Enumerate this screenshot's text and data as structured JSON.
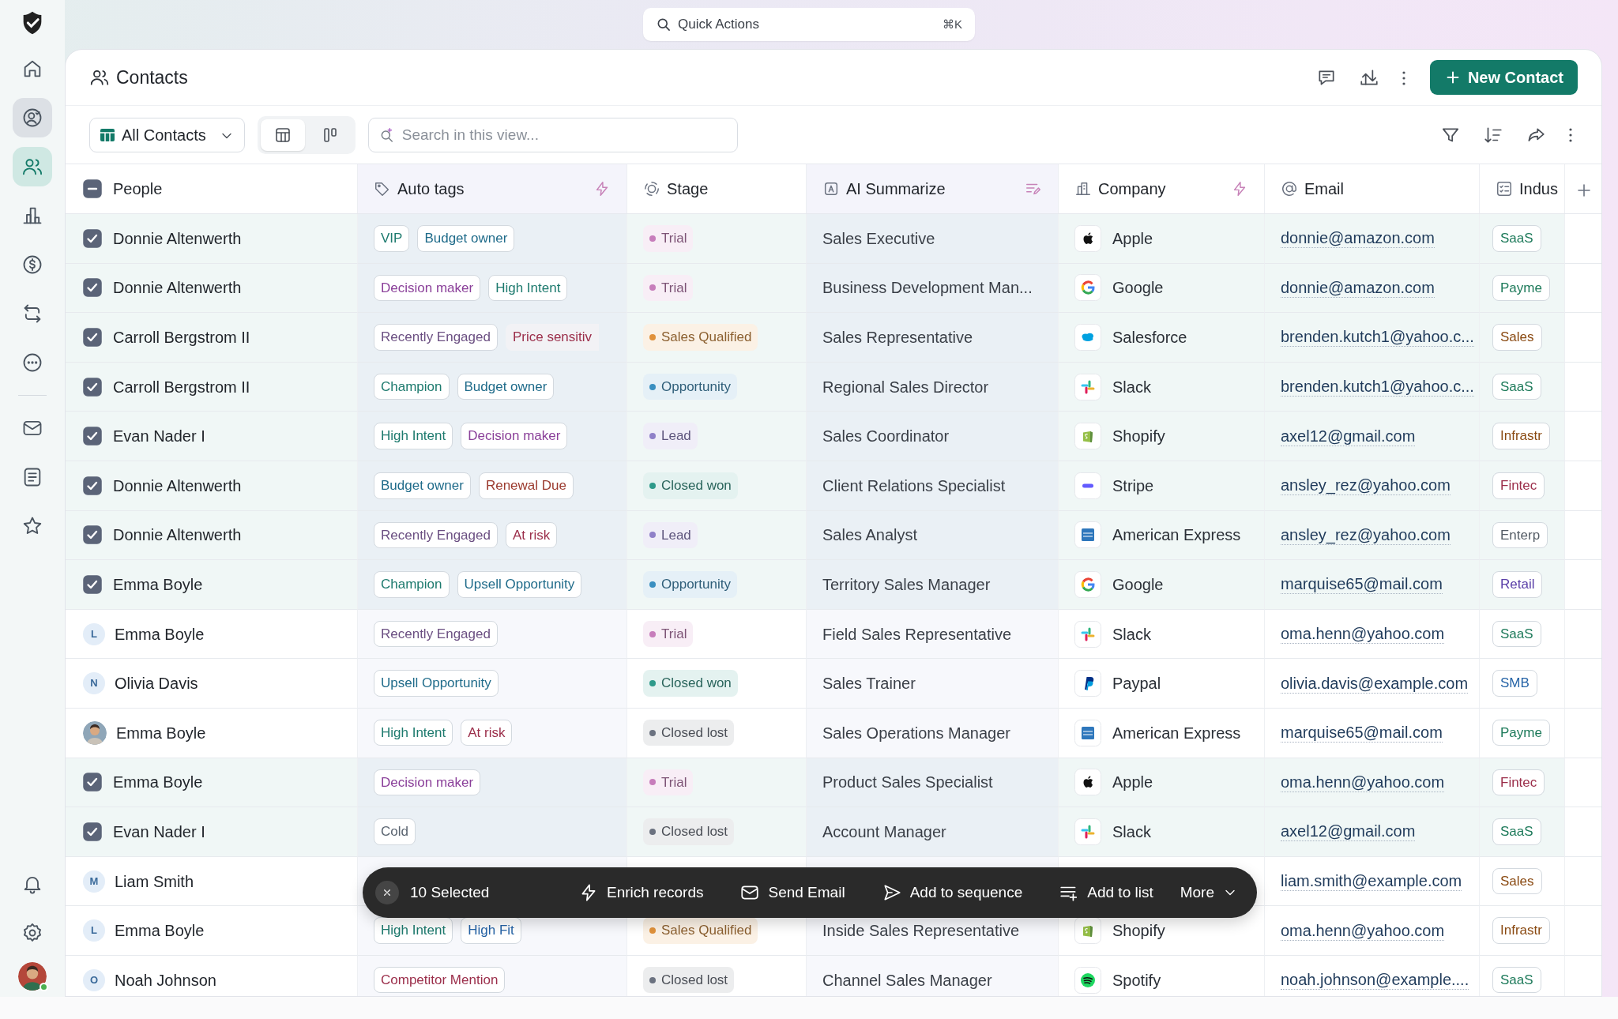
{
  "quick_actions": {
    "label": "Quick Actions",
    "shortcut": "⌘K"
  },
  "sidebar": {
    "items": [
      {
        "selected": false,
        "hovered": false
      },
      {
        "selected": false,
        "hovered": true
      },
      {
        "selected": true,
        "hovered": false
      },
      {
        "selected": false,
        "hovered": false
      },
      {
        "selected": false,
        "hovered": false
      },
      {
        "selected": false,
        "hovered": false
      },
      {
        "selected": false,
        "hovered": false
      },
      {
        "selected": false,
        "hovered": false
      },
      {
        "selected": false,
        "hovered": false
      },
      {
        "selected": false,
        "hovered": false
      }
    ],
    "bottom_items": [
      {
        "selected": false
      },
      {
        "selected": false
      }
    ],
    "user": {
      "online": true
    }
  },
  "header": {
    "title": "Contacts",
    "new_button": "New Contact"
  },
  "toolbar": {
    "view": "All Contacts",
    "view_modes": [
      {
        "selected": true
      },
      {
        "selected": false
      }
    ],
    "search": {
      "placeholder": "Search in this view..."
    }
  },
  "table": {
    "select_all": {
      "indeterminate": true
    },
    "columns": [
      {
        "label": "People"
      },
      {
        "label": "Auto tags"
      },
      {
        "label": "Stage"
      },
      {
        "label": "AI Summarize"
      },
      {
        "label": "Company"
      },
      {
        "label": "Email"
      },
      {
        "label": "Indus"
      }
    ],
    "rows": [
      {
        "checked": true,
        "name": "Donnie Altenwerth",
        "tags": [
          {
            "label": "VIP",
            "color": "#1d7a6e"
          },
          {
            "label": "Budget owner",
            "color": "#1f6b8a"
          }
        ],
        "stage": {
          "label": "Trial",
          "color": "#c77dbb"
        },
        "summary": "Sales Executive",
        "company": {
          "name": "Apple",
          "kind": "apple"
        },
        "email": "donnie@amazon.com",
        "industry": {
          "label": "SaaS",
          "color": "#1d7a5a"
        }
      },
      {
        "checked": true,
        "name": "Donnie Altenwerth",
        "tags": [
          {
            "label": "Decision maker",
            "color": "#8a3f99"
          },
          {
            "label": "High Intent",
            "color": "#1d7a6e"
          }
        ],
        "stage": {
          "label": "Trial",
          "color": "#c77dbb"
        },
        "summary": "Business Development Man...",
        "company": {
          "name": "Google",
          "kind": "google"
        },
        "email": "donnie@amazon.com",
        "industry": {
          "label": "Payme",
          "color": "#1d7a5a"
        }
      },
      {
        "checked": true,
        "name": "Carroll Bergstrom II",
        "tags": [
          {
            "label": "Recently Engaged",
            "color": "#6b4f82"
          },
          {
            "label": "Price sensitiv",
            "color": "#9b2e4a"
          }
        ],
        "stage": {
          "label": "Sales Qualified",
          "color": "#e0913a"
        },
        "summary": "Sales Representative",
        "company": {
          "name": "Salesforce",
          "kind": "salesforce"
        },
        "email": "brenden.kutch1@yahoo.c...",
        "industry": {
          "label": "Sales",
          "color": "#8a4a12"
        }
      },
      {
        "checked": true,
        "name": "Carroll Bergstrom II",
        "tags": [
          {
            "label": "Champion",
            "color": "#1d7a6e"
          },
          {
            "label": "Budget owner",
            "color": "#1f6b8a"
          }
        ],
        "stage": {
          "label": "Opportunity",
          "color": "#3a8fc0"
        },
        "summary": "Regional Sales Director",
        "company": {
          "name": "Slack",
          "kind": "slack"
        },
        "email": "brenden.kutch1@yahoo.c...",
        "industry": {
          "label": "SaaS",
          "color": "#1d7a5a"
        }
      },
      {
        "checked": true,
        "name": "Evan Nader I",
        "tags": [
          {
            "label": "High Intent",
            "color": "#1d7a6e"
          },
          {
            "label": "Decision maker",
            "color": "#8a3f99"
          }
        ],
        "stage": {
          "label": "Lead",
          "color": "#8f80c8"
        },
        "summary": "Sales Coordinator",
        "company": {
          "name": "Shopify",
          "kind": "shopify"
        },
        "email": "axel12@gmail.com",
        "industry": {
          "label": "Infrastr",
          "color": "#8a4a12"
        }
      },
      {
        "checked": true,
        "name": "Donnie Altenwerth",
        "tags": [
          {
            "label": "Budget owner",
            "color": "#1f6b8a"
          },
          {
            "label": "Renewal Due",
            "color": "#9b3a2e"
          }
        ],
        "stage": {
          "label": "Closed won",
          "color": "#2e9a8a"
        },
        "summary": "Client Relations Specialist",
        "company": {
          "name": "Stripe",
          "kind": "stripe"
        },
        "email": "ansley_rez@yahoo.com",
        "industry": {
          "label": "Fintec",
          "color": "#9b2e4a"
        }
      },
      {
        "checked": true,
        "name": "Donnie Altenwerth",
        "tags": [
          {
            "label": "Recently Engaged",
            "color": "#6b4f82"
          },
          {
            "label": "At risk",
            "color": "#9b2e4a"
          }
        ],
        "stage": {
          "label": "Lead",
          "color": "#8f80c8"
        },
        "summary": "Sales Analyst",
        "company": {
          "name": "American Express",
          "kind": "amex"
        },
        "email": "ansley_rez@yahoo.com",
        "industry": {
          "label": "Enterp",
          "color": "#555d66"
        }
      },
      {
        "checked": true,
        "name": "Emma Boyle",
        "tags": [
          {
            "label": "Champion",
            "color": "#1d7a6e"
          },
          {
            "label": "Upsell Opportunity",
            "color": "#1f6b8a"
          }
        ],
        "stage": {
          "label": "Opportunity",
          "color": "#3a8fc0"
        },
        "summary": "Territory Sales Manager",
        "company": {
          "name": "Google",
          "kind": "google"
        },
        "email": "marquise65@mail.com",
        "industry": {
          "label": "Retail",
          "color": "#5a3fa8"
        }
      },
      {
        "checked": false,
        "avatar": {
          "kind": "letter",
          "letter": "L"
        },
        "name": "Emma Boyle",
        "tags": [
          {
            "label": "Recently Engaged",
            "color": "#6b4f82"
          }
        ],
        "stage": {
          "label": "Trial",
          "color": "#c77dbb"
        },
        "summary": "Field Sales Representative",
        "company": {
          "name": "Slack",
          "kind": "slack"
        },
        "email": "oma.henn@yahoo.com",
        "industry": {
          "label": "SaaS",
          "color": "#1d7a5a"
        }
      },
      {
        "checked": false,
        "avatar": {
          "kind": "letter",
          "letter": "N"
        },
        "name": "Olivia Davis",
        "tags": [
          {
            "label": "Upsell Opportunity",
            "color": "#1f6b8a"
          }
        ],
        "stage": {
          "label": "Closed won",
          "color": "#2e9a8a"
        },
        "summary": "Sales Trainer",
        "company": {
          "name": "Paypal",
          "kind": "paypal"
        },
        "email": "olivia.davis@example.com",
        "industry": {
          "label": "SMB",
          "color": "#2563a6"
        }
      },
      {
        "checked": false,
        "name": "Emma Boyle",
        "tags": [
          {
            "label": "High Intent",
            "color": "#1d7a6e"
          },
          {
            "label": "At risk",
            "color": "#9b2e4a"
          }
        ],
        "stage": {
          "label": "Closed lost",
          "color": "#6b7280"
        },
        "summary": "Sales Operations Manager",
        "company": {
          "name": "American Express",
          "kind": "amex"
        },
        "email": "marquise65@mail.com",
        "industry": {
          "label": "Payme",
          "color": "#1d7a5a"
        }
      },
      {
        "checked": true,
        "name": "Emma Boyle",
        "tags": [
          {
            "label": "Decision maker",
            "color": "#8a3f99"
          }
        ],
        "stage": {
          "label": "Trial",
          "color": "#c77dbb"
        },
        "summary": "Product Sales Specialist",
        "company": {
          "name": "Apple",
          "kind": "apple"
        },
        "email": "oma.henn@yahoo.com",
        "industry": {
          "label": "Fintec",
          "color": "#9b2e4a"
        }
      },
      {
        "checked": true,
        "name": "Evan Nader I",
        "tags": [
          {
            "label": "Cold",
            "color": "#5a6470"
          }
        ],
        "stage": {
          "label": "Closed lost",
          "color": "#6b7280"
        },
        "summary": "Account Manager",
        "company": {
          "name": "Slack",
          "kind": "slack"
        },
        "email": "axel12@gmail.com",
        "industry": {
          "label": "SaaS",
          "color": "#1d7a5a"
        }
      },
      {
        "checked": false,
        "avatar": {
          "kind": "letter",
          "letter": "M"
        },
        "name": "Liam Smith",
        "email": "liam.smith@example.com",
        "industry": {
          "label": "Sales",
          "color": "#8a4a12"
        }
      },
      {
        "checked": false,
        "avatar": {
          "kind": "letter",
          "letter": "L"
        },
        "name": "Emma Boyle",
        "tags": [
          {
            "label": "High Intent",
            "color": "#1d7a6e"
          },
          {
            "label": "High Fit",
            "color": "#2563a6"
          }
        ],
        "stage": {
          "label": "Sales Qualified",
          "color": "#e0913a"
        },
        "summary": "Inside Sales Representative",
        "company": {
          "name": "Shopify",
          "kind": "shopify"
        },
        "email": "oma.henn@yahoo.com",
        "industry": {
          "label": "Infrastr",
          "color": "#8a4a12"
        }
      },
      {
        "checked": false,
        "avatar": {
          "kind": "letter",
          "letter": "O"
        },
        "name": "Noah Johnson",
        "tags": [
          {
            "label": "Competitor Mention",
            "color": "#9b2e4a"
          }
        ],
        "stage": {
          "label": "Closed lost",
          "color": "#6b7280"
        },
        "summary": "Channel Sales Manager",
        "company": {
          "name": "Spotify",
          "kind": "spotify"
        },
        "email": "noah.johnson@example....",
        "industry": {
          "label": "SaaS",
          "color": "#1d7a5a"
        }
      }
    ]
  },
  "selection_bar": {
    "count": "10 Selected",
    "actions": [
      {
        "label": "Enrich records"
      },
      {
        "label": "Send Email"
      },
      {
        "label": "Add to sequence"
      },
      {
        "label": "Add to list"
      },
      {
        "label": "More"
      }
    ]
  }
}
